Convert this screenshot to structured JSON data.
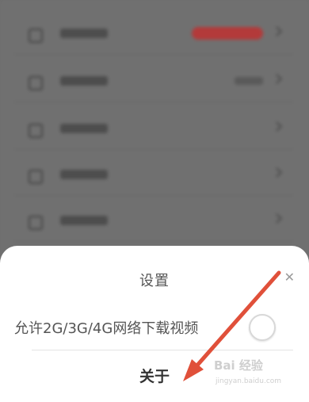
{
  "sheet": {
    "title": "设置",
    "option_label": "允许2G/3G/4G网络下载视频",
    "option_enabled": false,
    "about_label": "关于"
  },
  "background_rows": [
    {
      "has_badge": true
    },
    {
      "has_value": true
    },
    {},
    {},
    {}
  ],
  "colors": {
    "overlay": "#707070",
    "sheet_background": "#ffffff",
    "arrow": "#e0503a",
    "badge": "#b33a3a"
  },
  "watermark": {
    "line1": "Bai 经验",
    "line2": "jingyan.baidu.com"
  }
}
